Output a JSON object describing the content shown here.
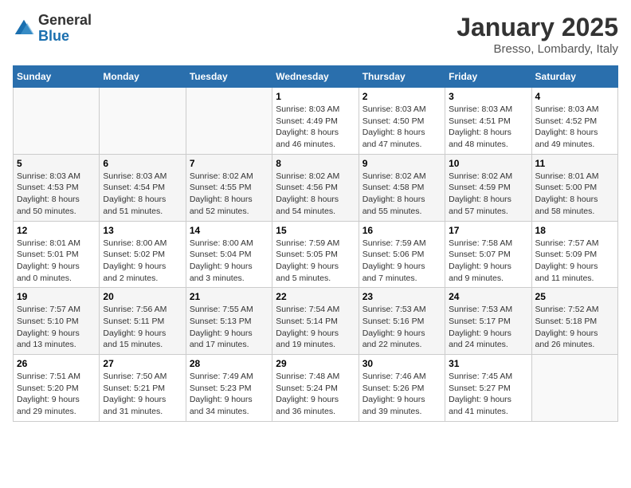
{
  "logo": {
    "general": "General",
    "blue": "Blue"
  },
  "title": "January 2025",
  "subtitle": "Bresso, Lombardy, Italy",
  "headers": [
    "Sunday",
    "Monday",
    "Tuesday",
    "Wednesday",
    "Thursday",
    "Friday",
    "Saturday"
  ],
  "weeks": [
    [
      {
        "day": "",
        "info": ""
      },
      {
        "day": "",
        "info": ""
      },
      {
        "day": "",
        "info": ""
      },
      {
        "day": "1",
        "info": "Sunrise: 8:03 AM\nSunset: 4:49 PM\nDaylight: 8 hours\nand 46 minutes."
      },
      {
        "day": "2",
        "info": "Sunrise: 8:03 AM\nSunset: 4:50 PM\nDaylight: 8 hours\nand 47 minutes."
      },
      {
        "day": "3",
        "info": "Sunrise: 8:03 AM\nSunset: 4:51 PM\nDaylight: 8 hours\nand 48 minutes."
      },
      {
        "day": "4",
        "info": "Sunrise: 8:03 AM\nSunset: 4:52 PM\nDaylight: 8 hours\nand 49 minutes."
      }
    ],
    [
      {
        "day": "5",
        "info": "Sunrise: 8:03 AM\nSunset: 4:53 PM\nDaylight: 8 hours\nand 50 minutes."
      },
      {
        "day": "6",
        "info": "Sunrise: 8:03 AM\nSunset: 4:54 PM\nDaylight: 8 hours\nand 51 minutes."
      },
      {
        "day": "7",
        "info": "Sunrise: 8:02 AM\nSunset: 4:55 PM\nDaylight: 8 hours\nand 52 minutes."
      },
      {
        "day": "8",
        "info": "Sunrise: 8:02 AM\nSunset: 4:56 PM\nDaylight: 8 hours\nand 54 minutes."
      },
      {
        "day": "9",
        "info": "Sunrise: 8:02 AM\nSunset: 4:58 PM\nDaylight: 8 hours\nand 55 minutes."
      },
      {
        "day": "10",
        "info": "Sunrise: 8:02 AM\nSunset: 4:59 PM\nDaylight: 8 hours\nand 57 minutes."
      },
      {
        "day": "11",
        "info": "Sunrise: 8:01 AM\nSunset: 5:00 PM\nDaylight: 8 hours\nand 58 minutes."
      }
    ],
    [
      {
        "day": "12",
        "info": "Sunrise: 8:01 AM\nSunset: 5:01 PM\nDaylight: 9 hours\nand 0 minutes."
      },
      {
        "day": "13",
        "info": "Sunrise: 8:00 AM\nSunset: 5:02 PM\nDaylight: 9 hours\nand 2 minutes."
      },
      {
        "day": "14",
        "info": "Sunrise: 8:00 AM\nSunset: 5:04 PM\nDaylight: 9 hours\nand 3 minutes."
      },
      {
        "day": "15",
        "info": "Sunrise: 7:59 AM\nSunset: 5:05 PM\nDaylight: 9 hours\nand 5 minutes."
      },
      {
        "day": "16",
        "info": "Sunrise: 7:59 AM\nSunset: 5:06 PM\nDaylight: 9 hours\nand 7 minutes."
      },
      {
        "day": "17",
        "info": "Sunrise: 7:58 AM\nSunset: 5:07 PM\nDaylight: 9 hours\nand 9 minutes."
      },
      {
        "day": "18",
        "info": "Sunrise: 7:57 AM\nSunset: 5:09 PM\nDaylight: 9 hours\nand 11 minutes."
      }
    ],
    [
      {
        "day": "19",
        "info": "Sunrise: 7:57 AM\nSunset: 5:10 PM\nDaylight: 9 hours\nand 13 minutes."
      },
      {
        "day": "20",
        "info": "Sunrise: 7:56 AM\nSunset: 5:11 PM\nDaylight: 9 hours\nand 15 minutes."
      },
      {
        "day": "21",
        "info": "Sunrise: 7:55 AM\nSunset: 5:13 PM\nDaylight: 9 hours\nand 17 minutes."
      },
      {
        "day": "22",
        "info": "Sunrise: 7:54 AM\nSunset: 5:14 PM\nDaylight: 9 hours\nand 19 minutes."
      },
      {
        "day": "23",
        "info": "Sunrise: 7:53 AM\nSunset: 5:16 PM\nDaylight: 9 hours\nand 22 minutes."
      },
      {
        "day": "24",
        "info": "Sunrise: 7:53 AM\nSunset: 5:17 PM\nDaylight: 9 hours\nand 24 minutes."
      },
      {
        "day": "25",
        "info": "Sunrise: 7:52 AM\nSunset: 5:18 PM\nDaylight: 9 hours\nand 26 minutes."
      }
    ],
    [
      {
        "day": "26",
        "info": "Sunrise: 7:51 AM\nSunset: 5:20 PM\nDaylight: 9 hours\nand 29 minutes."
      },
      {
        "day": "27",
        "info": "Sunrise: 7:50 AM\nSunset: 5:21 PM\nDaylight: 9 hours\nand 31 minutes."
      },
      {
        "day": "28",
        "info": "Sunrise: 7:49 AM\nSunset: 5:23 PM\nDaylight: 9 hours\nand 34 minutes."
      },
      {
        "day": "29",
        "info": "Sunrise: 7:48 AM\nSunset: 5:24 PM\nDaylight: 9 hours\nand 36 minutes."
      },
      {
        "day": "30",
        "info": "Sunrise: 7:46 AM\nSunset: 5:26 PM\nDaylight: 9 hours\nand 39 minutes."
      },
      {
        "day": "31",
        "info": "Sunrise: 7:45 AM\nSunset: 5:27 PM\nDaylight: 9 hours\nand 41 minutes."
      },
      {
        "day": "",
        "info": ""
      }
    ]
  ]
}
